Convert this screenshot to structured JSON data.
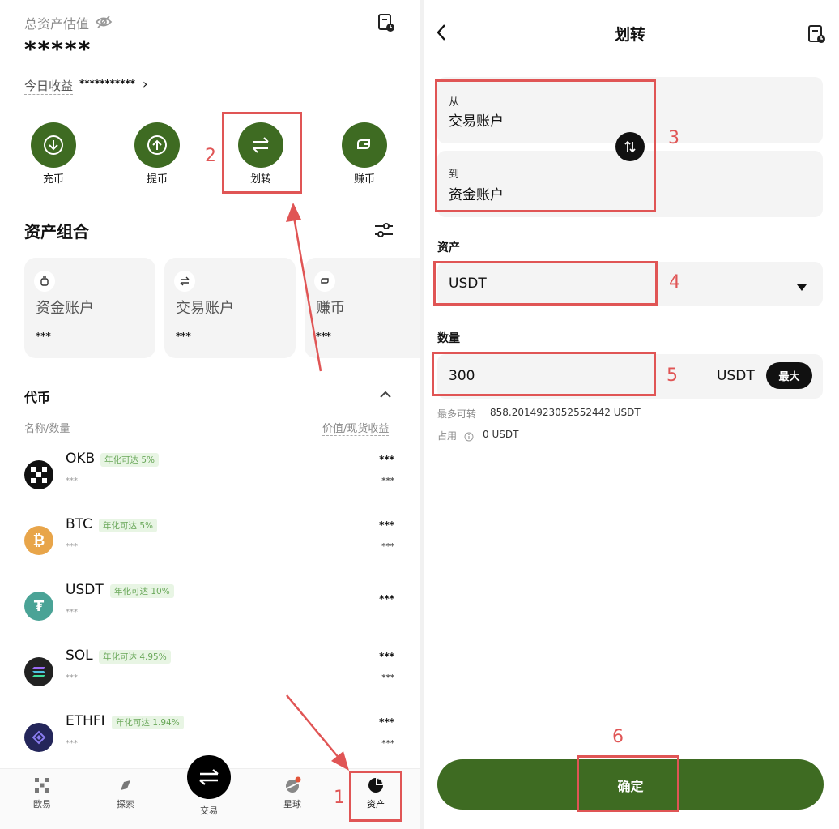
{
  "left": {
    "total_label": "总资产估值",
    "total_value": "*****",
    "today_label": "今日收益",
    "today_value": "***********",
    "actions": [
      {
        "label": "充币",
        "icon": "download-icon"
      },
      {
        "label": "提币",
        "icon": "upload-icon"
      },
      {
        "label": "划转",
        "icon": "transfer-icon"
      },
      {
        "label": "赚币",
        "icon": "earn-icon"
      }
    ],
    "portfolio_title": "资产组合",
    "cards": [
      {
        "title": "资金账户",
        "value": "***",
        "icon": "wallet-icon"
      },
      {
        "title": "交易账户",
        "value": "***",
        "icon": "swap-icon"
      },
      {
        "title": "赚币",
        "value": "***",
        "icon": "earn-icon"
      }
    ],
    "coins_section": "代币",
    "col_left": "名称/数量",
    "col_right": "价值/现货收益",
    "coins": [
      {
        "name": "OKB",
        "badge": "年化可达 5%",
        "sub": "***",
        "v1": "***",
        "v2": "***",
        "color": "#111111"
      },
      {
        "name": "BTC",
        "badge": "年化可达 5%",
        "sub": "***",
        "v1": "***",
        "v2": "***",
        "color": "#e8a54a"
      },
      {
        "name": "USDT",
        "badge": "年化可达 10%",
        "sub": "***",
        "v1": "***",
        "v2": "",
        "color": "#4aa396"
      },
      {
        "name": "SOL",
        "badge": "年化可达 4.95%",
        "sub": "***",
        "v1": "***",
        "v2": "***",
        "color": "#222222"
      },
      {
        "name": "ETHFI",
        "badge": "年化可达 1.94%",
        "sub": "***",
        "v1": "***",
        "v2": "***",
        "color": "#24265a"
      }
    ],
    "tabs": [
      {
        "label": "欧易",
        "icon": "okx-logo-icon"
      },
      {
        "label": "探索",
        "icon": "compass-icon"
      },
      {
        "label": "交易",
        "icon": "trade-icon"
      },
      {
        "label": "星球",
        "icon": "planet-icon"
      },
      {
        "label": "资产",
        "icon": "pie-chart-icon"
      }
    ]
  },
  "right": {
    "title": "划转",
    "from_label": "从",
    "from_value": "交易账户",
    "to_label": "到",
    "to_value": "资金账户",
    "asset_label": "资产",
    "asset_value": "USDT",
    "amount_label": "数量",
    "amount_value": "300",
    "amount_unit": "USDT",
    "max_label": "最大",
    "max_transfer_label": "最多可转",
    "max_transfer_value": "858.2014923052552442 USDT",
    "occupied_label": "占用",
    "occupied_value": "0 USDT",
    "confirm_label": "确定"
  },
  "annotations": [
    "1",
    "2",
    "3",
    "4",
    "5",
    "6"
  ],
  "colors": {
    "brand_green": "#3e6b22",
    "annotation_red": "#e05555"
  }
}
